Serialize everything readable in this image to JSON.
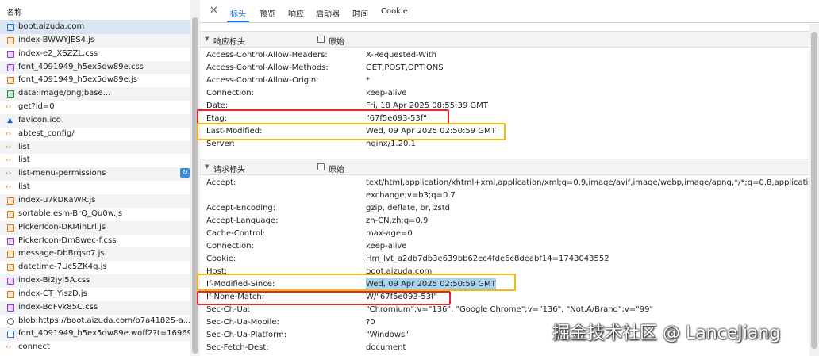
{
  "list_header": "名称",
  "requests": [
    {
      "name": "boot.aizuda.com",
      "icon": "doc"
    },
    {
      "name": "index-BWWYJES4.js",
      "icon": "js"
    },
    {
      "name": "index-e2_XSZZL.css",
      "icon": "css"
    },
    {
      "name": "font_4091949_h5ex5dw89e.css",
      "icon": "css"
    },
    {
      "name": "font_4091949_h5ex5dw89e.js",
      "icon": "js"
    },
    {
      "name": "data:image/png;base...",
      "icon": "img"
    },
    {
      "name": "get?id=0",
      "icon": "xhr"
    },
    {
      "name": "favicon.ico",
      "icon": "fav"
    },
    {
      "name": "abtest_config/",
      "icon": "xhr"
    },
    {
      "name": "list",
      "icon": "xhr"
    },
    {
      "name": "list",
      "icon": "xhr"
    },
    {
      "name": "list-menu-permissions",
      "icon": "xhr"
    },
    {
      "name": "list",
      "icon": "xhr"
    },
    {
      "name": "index-u7kDKaWR.js",
      "icon": "js"
    },
    {
      "name": "sortable.esm-BrQ_Qu0w.js",
      "icon": "js"
    },
    {
      "name": "PickerIcon-DKMihLrl.js",
      "icon": "js"
    },
    {
      "name": "PickerIcon-Dm8wec-f.css",
      "icon": "css"
    },
    {
      "name": "message-DbBrqso7.js",
      "icon": "js"
    },
    {
      "name": "datetime-7Uc5ZK4q.js",
      "icon": "js"
    },
    {
      "name": "index-Bi2jyI5A.css",
      "icon": "css"
    },
    {
      "name": "index-CT_YiszD.js",
      "icon": "js"
    },
    {
      "name": "index-BqFvk85C.css",
      "icon": "css"
    },
    {
      "name": "blob:https://boot.aizuda.com/b7a41825-a...",
      "icon": "blob"
    },
    {
      "name": "font_4091949_h5ex5dw89e.woff2?t=169698...",
      "icon": "font"
    },
    {
      "name": "connect",
      "icon": "xhr"
    }
  ],
  "tabs": [
    "标头",
    "预览",
    "响应",
    "启动器",
    "时间",
    "Cookie"
  ],
  "response_section": {
    "title": "响应标头",
    "raw_label": "原始",
    "headers": [
      {
        "k": "Access-Control-Allow-Headers:",
        "v": "X-Requested-With"
      },
      {
        "k": "Access-Control-Allow-Methods:",
        "v": "GET,POST,OPTIONS"
      },
      {
        "k": "Access-Control-Allow-Origin:",
        "v": "*"
      },
      {
        "k": "Connection:",
        "v": "keep-alive"
      },
      {
        "k": "Date:",
        "v": "Fri, 18 Apr 2025 08:55:39 GMT"
      },
      {
        "k": "Etag:",
        "v": "\"67f5e093-53f\""
      },
      {
        "k": "Last-Modified:",
        "v": "Wed, 09 Apr 2025 02:50:59 GMT"
      },
      {
        "k": "Server:",
        "v": "nginx/1.20.1"
      }
    ]
  },
  "request_section": {
    "title": "请求标头",
    "raw_label": "原始",
    "headers": [
      {
        "k": "Accept:",
        "v": "text/html,application/xhtml+xml,application/xml;q=0.9,image/avif,image/webp,image/apng,*/*;q=0.8,application/signed-exchange;v=b3;q=0.7"
      },
      {
        "k": "Accept-Encoding:",
        "v": "gzip, deflate, br, zstd"
      },
      {
        "k": "Accept-Language:",
        "v": "zh-CN,zh;q=0.9"
      },
      {
        "k": "Cache-Control:",
        "v": "max-age=0"
      },
      {
        "k": "Connection:",
        "v": "keep-alive"
      },
      {
        "k": "Cookie:",
        "v": "Hm_lvt_a2db7db3e639bb62ec4fde6c8deabf14=1743043552"
      },
      {
        "k": "Host:",
        "v": "boot.aizuda.com"
      },
      {
        "k": "If-Modified-Since:",
        "v": "Wed, 09 Apr 2025 02:50:59 GMT"
      },
      {
        "k": "If-None-Match:",
        "v": "W/\"67f5e093-53f\""
      },
      {
        "k": "Sec-Ch-Ua:",
        "v": "\"Chromium\";v=\"136\", \"Google Chrome\";v=\"136\", \"Not.A/Brand\";v=\"99\""
      },
      {
        "k": "Sec-Ch-Ua-Mobile:",
        "v": "?0"
      },
      {
        "k": "Sec-Ch-Ua-Platform:",
        "v": "\"Windows\""
      },
      {
        "k": "Sec-Fetch-Dest:",
        "v": "document"
      }
    ]
  },
  "watermark": "掘金技术社区 @ LanceJiang",
  "colors": {
    "accent": "#1a73e8",
    "red_box": "#e8262a",
    "yellow_box": "#f5b70a",
    "selection": "#a8d3f0"
  }
}
